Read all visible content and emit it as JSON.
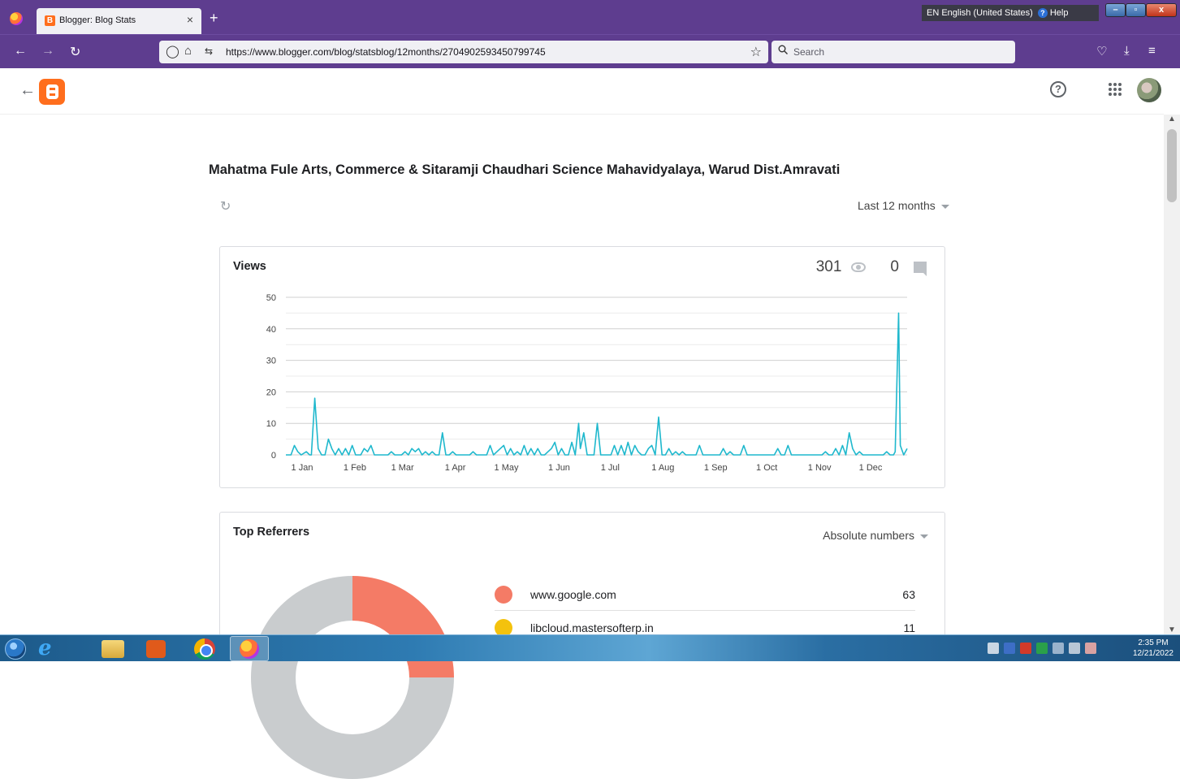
{
  "browser": {
    "tab_title": "Blogger: Blog Stats",
    "tab_close": "×",
    "new_tab": "+",
    "url": "https://www.blogger.com/blog/statsblog/12months/2704902593450799745",
    "search_placeholder": "Search",
    "language_bar": {
      "language": "EN English (United States)",
      "help": "Help"
    }
  },
  "blogger": {
    "help_icon": "?",
    "blog_title": "Mahatma Fule Arts, Commerce & Sitaramji Chaudhari Science Mahavidyalaya, Warud Dist.Amravati",
    "range": "Last 12 months"
  },
  "views_card": {
    "title": "Views",
    "views_count": "301",
    "comments_count": "0"
  },
  "chart_data": {
    "type": "line",
    "title": "Views",
    "x_tick_labels": [
      "1 Jan",
      "1 Feb",
      "1 Mar",
      "1 Apr",
      "1 May",
      "1 Jun",
      "1 Jul",
      "1 Aug",
      "1 Sep",
      "1 Oct",
      "1 Nov",
      "1 Dec"
    ],
    "y_tick_labels": [
      "0",
      "10",
      "20",
      "30",
      "40",
      "50"
    ],
    "ylim": [
      0,
      50
    ],
    "xlim": [
      0,
      365
    ],
    "grid": true,
    "color": "#1fb8cd",
    "series": [
      {
        "points": [
          [
            0,
            0
          ],
          [
            3,
            0
          ],
          [
            5,
            3
          ],
          [
            7,
            1
          ],
          [
            9,
            0
          ],
          [
            12,
            1
          ],
          [
            14,
            0
          ],
          [
            15,
            0
          ],
          [
            17,
            18
          ],
          [
            19,
            2
          ],
          [
            21,
            0
          ],
          [
            23,
            0
          ],
          [
            25,
            5
          ],
          [
            27,
            2
          ],
          [
            29,
            0
          ],
          [
            31,
            2
          ],
          [
            33,
            0
          ],
          [
            35,
            2
          ],
          [
            37,
            0
          ],
          [
            39,
            3
          ],
          [
            41,
            0
          ],
          [
            43,
            0
          ],
          [
            44,
            0
          ],
          [
            46,
            2
          ],
          [
            48,
            1
          ],
          [
            50,
            3
          ],
          [
            52,
            0
          ],
          [
            54,
            0
          ],
          [
            56,
            0
          ],
          [
            58,
            0
          ],
          [
            60,
            0
          ],
          [
            62,
            1
          ],
          [
            64,
            0
          ],
          [
            66,
            0
          ],
          [
            68,
            0
          ],
          [
            70,
            1
          ],
          [
            72,
            0
          ],
          [
            74,
            2
          ],
          [
            76,
            1
          ],
          [
            78,
            2
          ],
          [
            80,
            0
          ],
          [
            82,
            1
          ],
          [
            84,
            0
          ],
          [
            86,
            1
          ],
          [
            88,
            0
          ],
          [
            90,
            0
          ],
          [
            92,
            7
          ],
          [
            94,
            0
          ],
          [
            96,
            0
          ],
          [
            98,
            1
          ],
          [
            100,
            0
          ],
          [
            102,
            0
          ],
          [
            104,
            0
          ],
          [
            106,
            0
          ],
          [
            108,
            0
          ],
          [
            110,
            1
          ],
          [
            112,
            0
          ],
          [
            114,
            0
          ],
          [
            116,
            0
          ],
          [
            118,
            0
          ],
          [
            120,
            3
          ],
          [
            122,
            0
          ],
          [
            124,
            1
          ],
          [
            126,
            2
          ],
          [
            128,
            3
          ],
          [
            130,
            0
          ],
          [
            132,
            2
          ],
          [
            134,
            0
          ],
          [
            136,
            1
          ],
          [
            138,
            0
          ],
          [
            140,
            3
          ],
          [
            142,
            0
          ],
          [
            144,
            2
          ],
          [
            146,
            0
          ],
          [
            148,
            2
          ],
          [
            150,
            0
          ],
          [
            152,
            0
          ],
          [
            154,
            1
          ],
          [
            156,
            2
          ],
          [
            158,
            4
          ],
          [
            160,
            0
          ],
          [
            162,
            2
          ],
          [
            164,
            0
          ],
          [
            166,
            0
          ],
          [
            168,
            4
          ],
          [
            170,
            0
          ],
          [
            172,
            10
          ],
          [
            173,
            2
          ],
          [
            175,
            7
          ],
          [
            177,
            0
          ],
          [
            179,
            0
          ],
          [
            181,
            0
          ],
          [
            183,
            10
          ],
          [
            185,
            0
          ],
          [
            187,
            0
          ],
          [
            189,
            0
          ],
          [
            191,
            0
          ],
          [
            193,
            3
          ],
          [
            195,
            0
          ],
          [
            197,
            3
          ],
          [
            199,
            0
          ],
          [
            201,
            4
          ],
          [
            203,
            0
          ],
          [
            205,
            3
          ],
          [
            207,
            1
          ],
          [
            209,
            0
          ],
          [
            211,
            0
          ],
          [
            213,
            2
          ],
          [
            215,
            3
          ],
          [
            217,
            0
          ],
          [
            219,
            12
          ],
          [
            221,
            0
          ],
          [
            223,
            0
          ],
          [
            225,
            2
          ],
          [
            227,
            0
          ],
          [
            229,
            1
          ],
          [
            231,
            0
          ],
          [
            233,
            1
          ],
          [
            235,
            0
          ],
          [
            237,
            0
          ],
          [
            239,
            0
          ],
          [
            241,
            0
          ],
          [
            243,
            3
          ],
          [
            245,
            0
          ],
          [
            247,
            0
          ],
          [
            249,
            0
          ],
          [
            251,
            0
          ],
          [
            253,
            0
          ],
          [
            255,
            0
          ],
          [
            257,
            2
          ],
          [
            259,
            0
          ],
          [
            261,
            1
          ],
          [
            263,
            0
          ],
          [
            265,
            0
          ],
          [
            267,
            0
          ],
          [
            269,
            3
          ],
          [
            271,
            0
          ],
          [
            273,
            0
          ],
          [
            275,
            0
          ],
          [
            277,
            0
          ],
          [
            279,
            0
          ],
          [
            281,
            0
          ],
          [
            283,
            0
          ],
          [
            285,
            0
          ],
          [
            287,
            0
          ],
          [
            289,
            2
          ],
          [
            291,
            0
          ],
          [
            293,
            0
          ],
          [
            295,
            3
          ],
          [
            297,
            0
          ],
          [
            299,
            0
          ],
          [
            301,
            0
          ],
          [
            303,
            0
          ],
          [
            305,
            0
          ],
          [
            307,
            0
          ],
          [
            309,
            0
          ],
          [
            311,
            0
          ],
          [
            313,
            0
          ],
          [
            315,
            0
          ],
          [
            317,
            1
          ],
          [
            319,
            0
          ],
          [
            321,
            0
          ],
          [
            323,
            2
          ],
          [
            325,
            0
          ],
          [
            327,
            3
          ],
          [
            329,
            0
          ],
          [
            331,
            7
          ],
          [
            333,
            2
          ],
          [
            335,
            0
          ],
          [
            337,
            1
          ],
          [
            339,
            0
          ],
          [
            341,
            0
          ],
          [
            343,
            0
          ],
          [
            345,
            0
          ],
          [
            347,
            0
          ],
          [
            349,
            0
          ],
          [
            351,
            0
          ],
          [
            353,
            1
          ],
          [
            355,
            0
          ],
          [
            357,
            0
          ],
          [
            358,
            1
          ],
          [
            360,
            45
          ],
          [
            361,
            3
          ],
          [
            363,
            0
          ],
          [
            365,
            2
          ]
        ]
      }
    ]
  },
  "referrers_card": {
    "title": "Top Referrers",
    "mode": "Absolute numbers",
    "items": [
      {
        "name": "www.google.com",
        "count": "63",
        "color": "#f47b66"
      },
      {
        "name": "libcloud.mastersofterp.in",
        "count": "11",
        "color": "#f4c20d"
      }
    ]
  },
  "taskbar": {
    "clock_time": "2:35 PM",
    "clock_date": "12/21/2022"
  },
  "icons": [
    "firefox-logo",
    "blogger-favicon",
    "back-arrow-icon",
    "forward-arrow-icon",
    "reload-icon",
    "shield-icon",
    "lock-icon",
    "permissions-icon",
    "star-icon",
    "search-icon",
    "pocket-icon",
    "download-icon",
    "menu-icon",
    "blogger-logo",
    "help-icon",
    "apps-icon",
    "avatar",
    "refresh-icon",
    "eye-icon",
    "comment-icon"
  ]
}
